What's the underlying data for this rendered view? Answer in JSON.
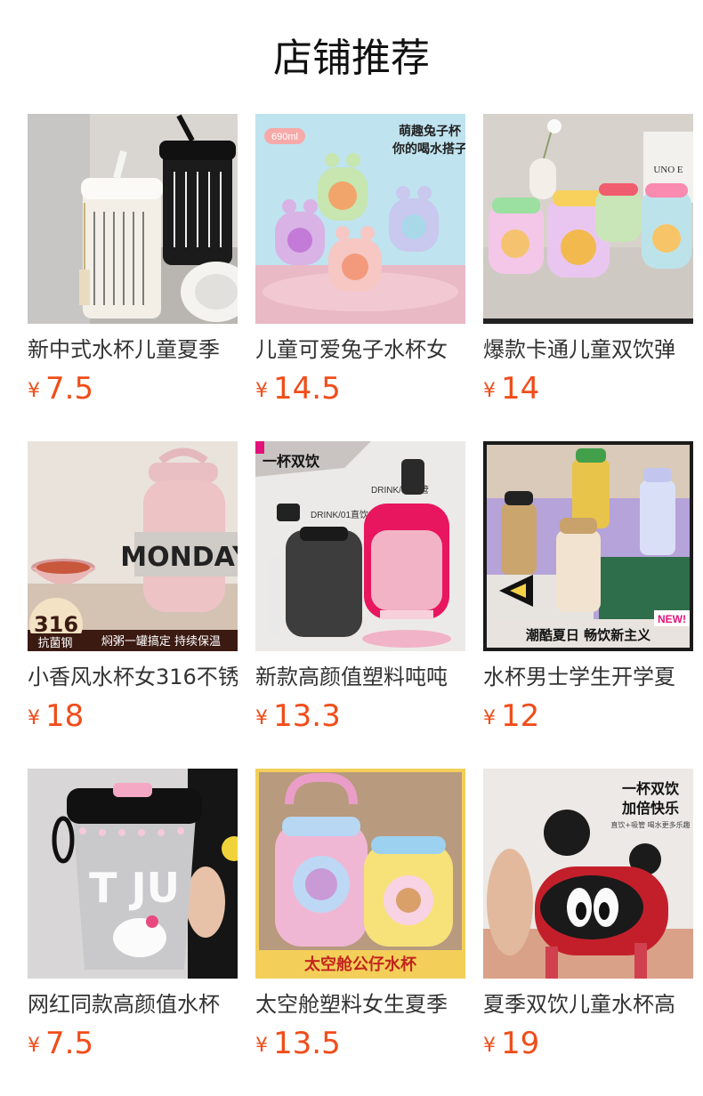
{
  "section": {
    "title": "店铺推荐"
  },
  "currency": "¥",
  "products": [
    {
      "title": "新中式水杯儿童夏季",
      "price": "7.5",
      "image": "white-calligraphy-straw-cup"
    },
    {
      "title": "儿童可爱兔子水杯女",
      "price": "14.5",
      "image": "bunny-water-bottles",
      "overlay": {
        "badge": "690ml",
        "line1": "萌趣兔子杯",
        "line2": "你的喝水搭子"
      }
    },
    {
      "title": "爆款卡通儿童双饮弹",
      "price": "14",
      "image": "cartoon-kids-bottles",
      "overlay": {
        "sign": "UNO E"
      }
    },
    {
      "title": "小香风水杯女316不锈",
      "price": "18",
      "image": "pink-monday-food-jar",
      "overlay": {
        "word": "MONDAY",
        "big": "316",
        "small": "抗菌钢",
        "bar": "焖粥一罐搞定  持续保温"
      }
    },
    {
      "title": "新款高颜值塑料吨吨",
      "price": "13.3",
      "image": "black-and-pink-straw-bottles",
      "overlay": {
        "tag1": "DRINK/02吸管",
        "tag2": "DRINK/01直饮",
        "stamp": "一杯双饮"
      }
    },
    {
      "title": "水杯男士学生开学夏",
      "price": "12",
      "image": "sports-kettle-set",
      "overlay": {
        "bar": "潮酷夏日  畅饮新主义",
        "newtag": "NEW!"
      }
    },
    {
      "title": "网红同款高颜值水杯",
      "price": "7.5",
      "image": "hello-kitty-tumbler",
      "overlay": {
        "word": "T JU"
      }
    },
    {
      "title": "太空舱塑料女生夏季",
      "price": "13.5",
      "image": "space-capsule-bottles",
      "overlay": {
        "bar": "太空舱公仔水杯"
      }
    },
    {
      "title": "夏季双饮儿童水杯高",
      "price": "19",
      "image": "red-mickey-style-bottle",
      "overlay": {
        "line1": "一杯双饮",
        "line2": "加倍快乐",
        "line3": "直饮+吸管 喝水更多乐趣"
      }
    }
  ],
  "colors": {
    "price": "#f04d1a",
    "title": "#333333",
    "heading": "#111111"
  }
}
